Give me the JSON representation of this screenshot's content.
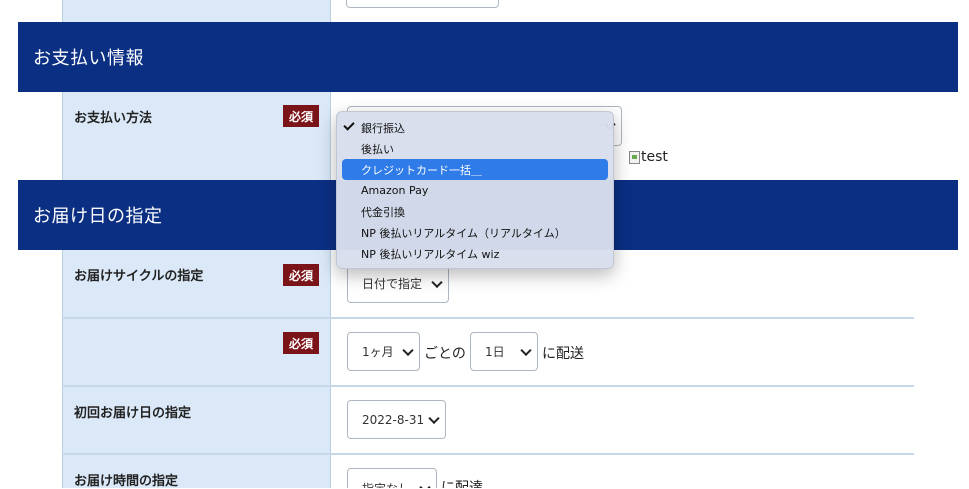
{
  "sections": {
    "payment": {
      "title": "お支払い情報"
    },
    "delivery": {
      "title": "お届け日の指定"
    }
  },
  "payment_method": {
    "label": "お支払い方法",
    "required": "必須",
    "options": [
      "銀行振込",
      "後払い",
      "クレジットカード一括＿",
      "Amazon Pay",
      "代金引換",
      "NP 後払いリアルタイム（リアルタイム）",
      "NP 後払いリアルタイム wiz"
    ],
    "checked_option": "銀行振込",
    "highlighted_option": "クレジットカード一括＿",
    "image_alt": "test"
  },
  "delivery_cycle": {
    "label": "お届けサイクルの指定",
    "required": "必須",
    "select_value": "日付で指定"
  },
  "cycle_interval": {
    "required": "必須",
    "month_value": "1ヶ月",
    "text_every": "ごとの",
    "day_value": "1日",
    "text_deliver": "に配送"
  },
  "first_delivery": {
    "label": "初回お届け日の指定",
    "date_value": "2022-8-31"
  },
  "delivery_time": {
    "label": "お届け時間の指定",
    "select_value": "指定なし",
    "text_deliver": "に配達"
  },
  "colors": {
    "header_bg": "#0b2f83",
    "label_cell_bg": "#dae8f7",
    "badge_bg": "#7b1418",
    "dropdown_highlight": "#2f7be8"
  }
}
